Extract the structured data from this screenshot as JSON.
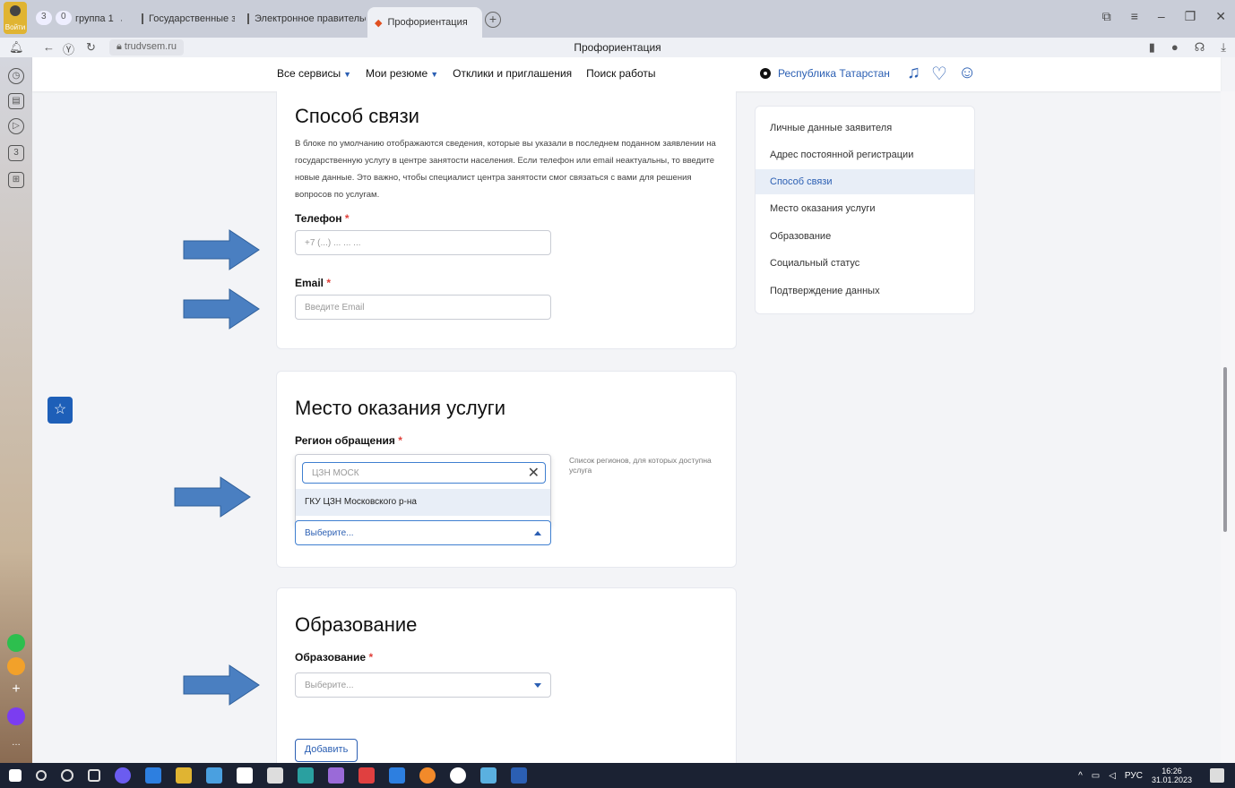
{
  "browser": {
    "login_label": "Войти",
    "tab_counts": [
      "3",
      "0"
    ],
    "tabs": [
      "группа 1",
      "Государственные закупк",
      "Электронное правительст",
      "Профориентация"
    ],
    "url": "trudvsem.ru",
    "page_title": "Профориентация"
  },
  "header": {
    "nav": [
      {
        "label": "Все сервисы",
        "dropdown": true
      },
      {
        "label": "Мои резюме",
        "dropdown": true
      },
      {
        "label": "Отклики и приглашения",
        "dropdown": false
      },
      {
        "label": "Поиск работы",
        "dropdown": false
      }
    ],
    "region": "Республика Татарстан"
  },
  "contact": {
    "title": "Способ связи",
    "description": "В блоке по умолчанию отображаются сведения, которые вы указали в последнем поданном заявлении на государственную услугу в центре занятости населения. Если телефон или email неактуальны, то введите новые данные. Это важно, чтобы специалист центра занятости смог связаться с вами для решения вопросов по услугам.",
    "phone_label": "Телефон",
    "phone_placeholder": "+7 (...) ... ... ...",
    "email_label": "Email",
    "email_placeholder": "Введите Email",
    "required_mark": "*"
  },
  "service_place": {
    "title": "Место оказания услуги",
    "region_label": "Регион обращения",
    "search_value": "ЦЗН МОСК",
    "option": "ГКУ ЦЗН Московского р-на",
    "select_value": "Выберите...",
    "hint": "Список регионов, для которых доступна услуга"
  },
  "education": {
    "title": "Образование",
    "label": "Образование",
    "select_value": "Выберите...",
    "add_button": "Добавить"
  },
  "side_nav": {
    "items": [
      {
        "label": "Личные данные заявителя",
        "active": false
      },
      {
        "label": "Адрес постоянной регистрации",
        "active": false
      },
      {
        "label": "Способ связи",
        "active": true
      },
      {
        "label": "Место оказания услуги",
        "active": false
      },
      {
        "label": "Образование",
        "active": false
      },
      {
        "label": "Социальный статус",
        "active": false
      },
      {
        "label": "Подтверждение данных",
        "active": false
      }
    ]
  },
  "taskbar": {
    "lang": "РУС",
    "time": "16:26",
    "date": "31.01.2023"
  },
  "colors": {
    "accent": "#2b5fb3",
    "arrow": "#4a7fc1",
    "required": "#e0403a"
  }
}
